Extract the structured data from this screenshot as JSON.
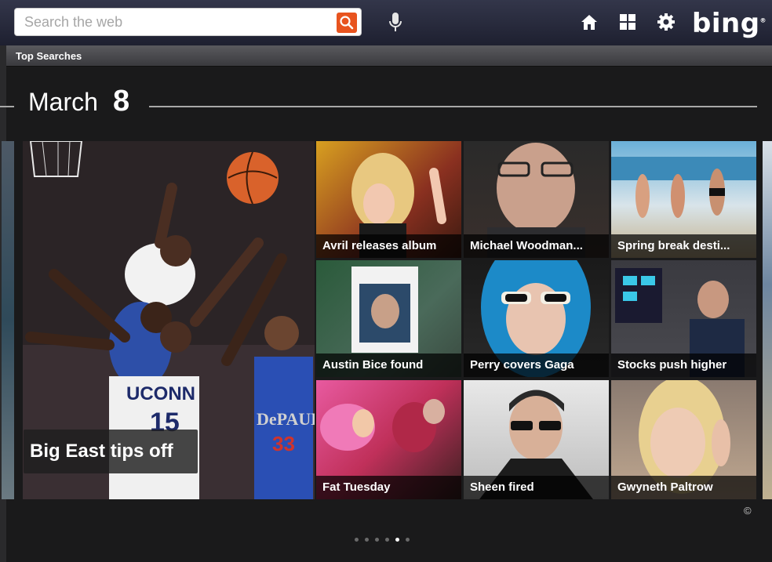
{
  "search": {
    "placeholder": "Search the web",
    "value": ""
  },
  "header": {
    "logo": "bing",
    "logo_mark": "®"
  },
  "icons": {
    "search": "search-icon",
    "mic": "microphone-icon",
    "home": "home-icon",
    "apps": "grid-icon",
    "settings": "gear-icon"
  },
  "top_searches": {
    "label": "Top Searches"
  },
  "date": {
    "month": "March",
    "day": "8"
  },
  "featured": {
    "caption": "Big East tips off"
  },
  "tiles": [
    {
      "caption": "Avril releases album"
    },
    {
      "caption": "Michael Woodman..."
    },
    {
      "caption": "Spring break desti..."
    },
    {
      "caption": "Austin Bice found"
    },
    {
      "caption": "Perry covers Gaga"
    },
    {
      "caption": "Stocks push higher"
    },
    {
      "caption": "Fat Tuesday"
    },
    {
      "caption": "Sheen fired"
    },
    {
      "caption": "Gwyneth Paltrow"
    }
  ],
  "footer": {
    "copyright": "©"
  },
  "pager": {
    "count": 6,
    "active_index": 4
  },
  "colors": {
    "accent": "#e8541f",
    "topbar": "#2a2c3e",
    "background": "#1a1a1b"
  }
}
